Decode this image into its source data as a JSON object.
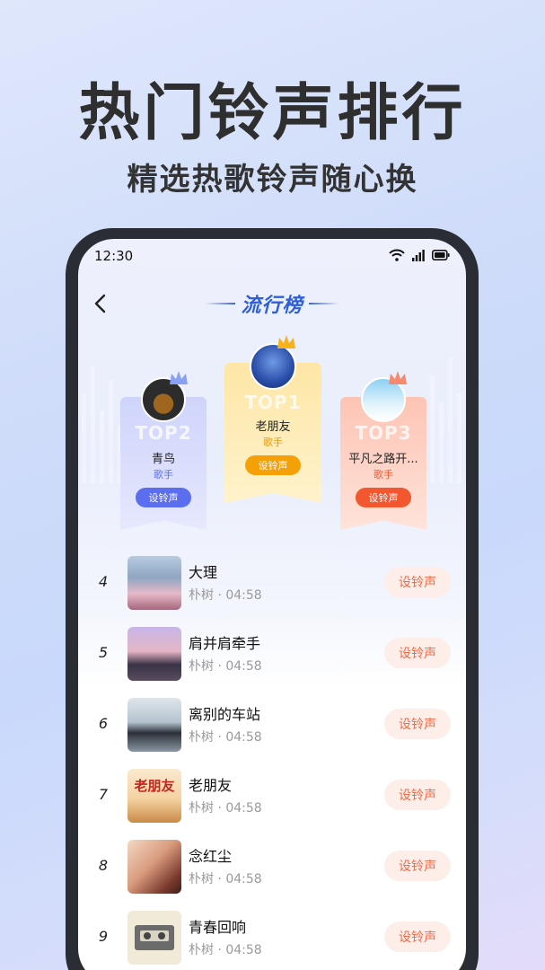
{
  "promo": {
    "headline": "热门铃声排行",
    "subline": "精选热歌铃声随心换"
  },
  "status_bar": {
    "time": "12:30",
    "icons": [
      "wifi-icon",
      "signal-icon",
      "battery-icon"
    ]
  },
  "nav": {
    "title": "流行榜",
    "back_icon": "chevron-left-icon"
  },
  "podium": [
    {
      "rank_label": "TOP2",
      "song": "青鸟",
      "artist": "歌手",
      "button": "设铃声",
      "accent": "#5b6ef0"
    },
    {
      "rank_label": "TOP1",
      "song": "老朋友",
      "artist": "歌手",
      "button": "设铃声",
      "accent": "#f6a008"
    },
    {
      "rank_label": "TOP3",
      "song": "平凡之路开...",
      "artist": "歌手",
      "button": "设铃声",
      "accent": "#f2572f"
    }
  ],
  "list": [
    {
      "rank": "4",
      "title": "大理",
      "artist": "朴树",
      "duration": "04:58",
      "button": "设铃声"
    },
    {
      "rank": "5",
      "title": "肩并肩牵手",
      "artist": "朴树",
      "duration": "04:58",
      "button": "设铃声"
    },
    {
      "rank": "6",
      "title": "离别的车站",
      "artist": "朴树",
      "duration": "04:58",
      "button": "设铃声"
    },
    {
      "rank": "7",
      "title": "老朋友",
      "artist": "朴树",
      "duration": "04:58",
      "button": "设铃声",
      "cover_text": "老朋友"
    },
    {
      "rank": "8",
      "title": "念红尘",
      "artist": "朴树",
      "duration": "04:58",
      "button": "设铃声"
    },
    {
      "rank": "9",
      "title": "青春回响",
      "artist": "朴树",
      "duration": "04:58",
      "button": "设铃声"
    }
  ],
  "meta_separator": "·",
  "colors": {
    "primary_blue": "#2f5fd8",
    "list_button_bg": "#fdeee9",
    "list_button_text": "#f26a45"
  }
}
